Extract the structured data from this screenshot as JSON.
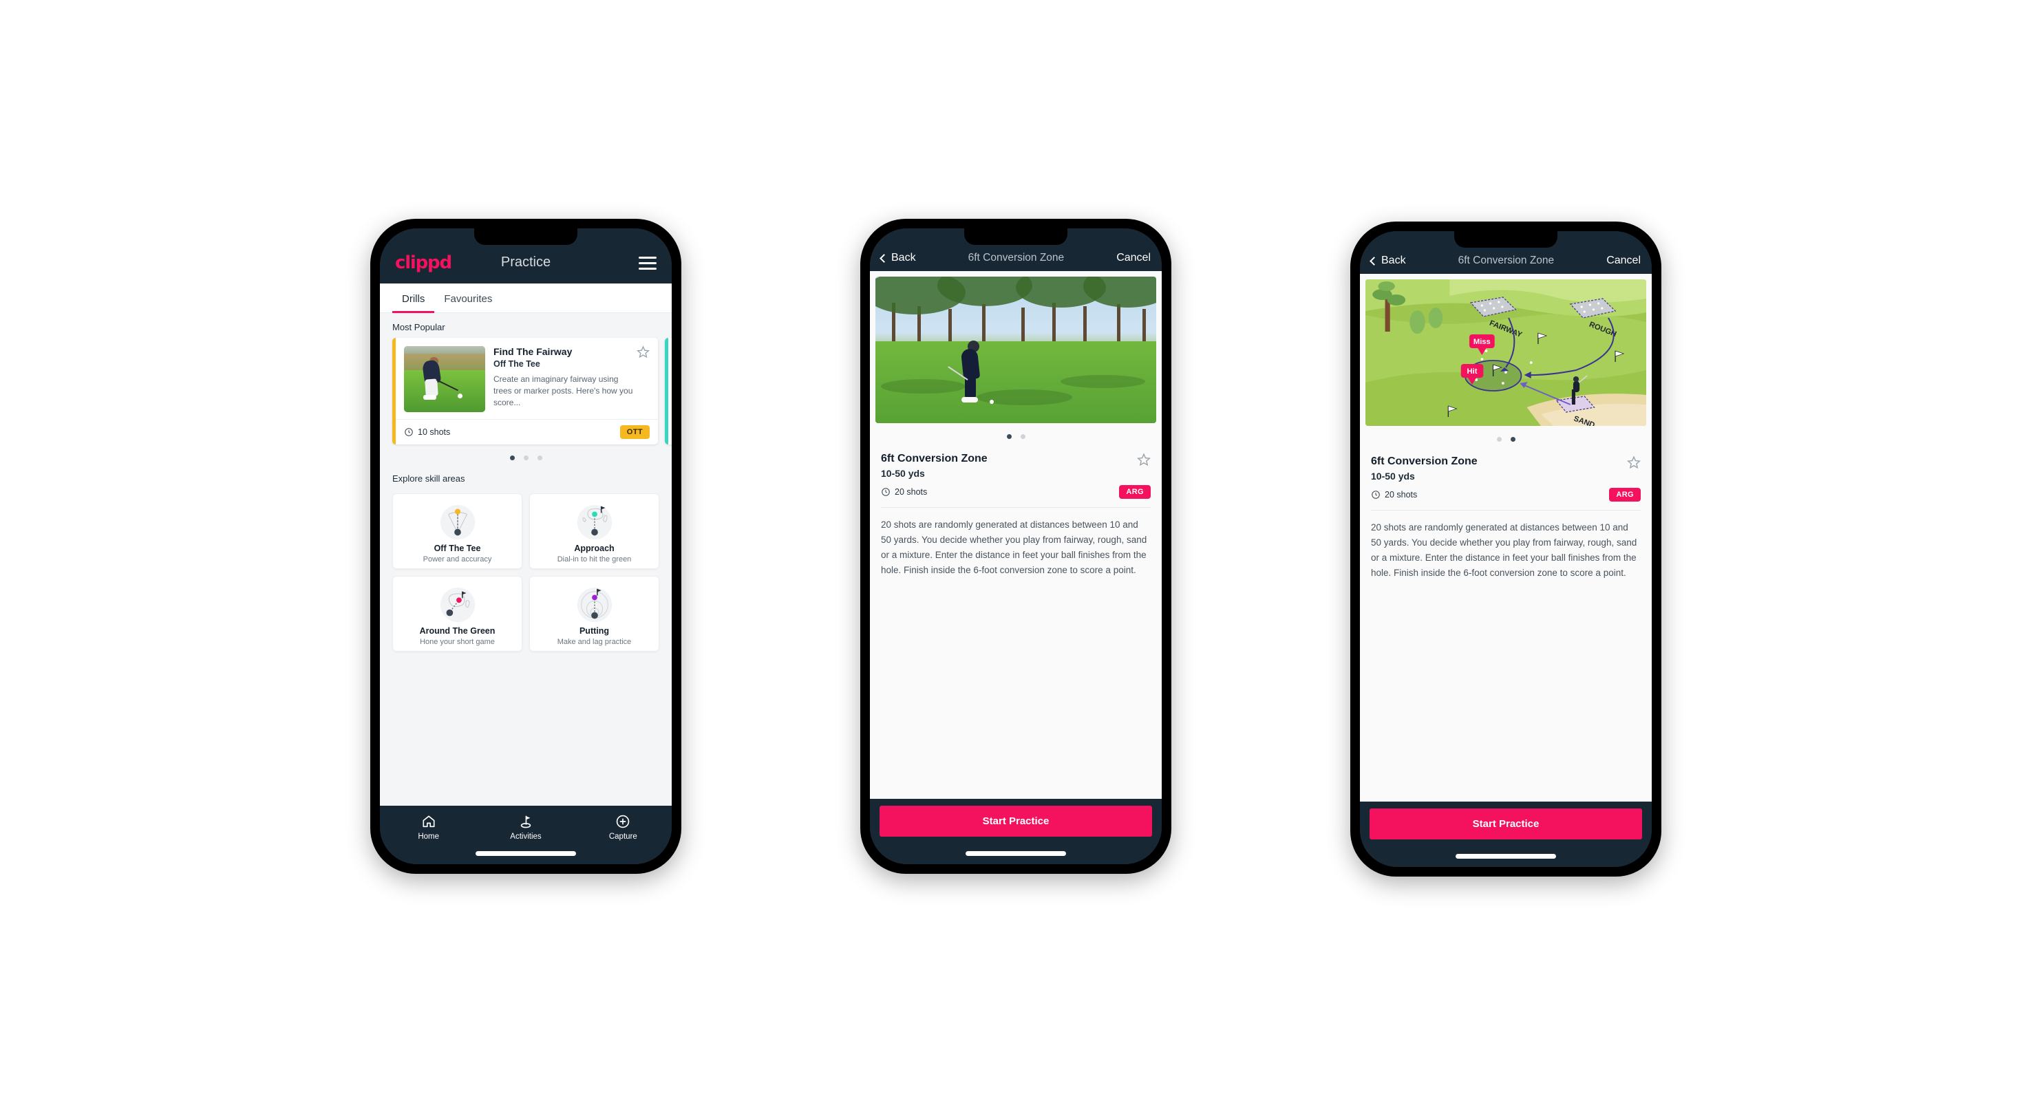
{
  "brand": {
    "logo_text": "clippd",
    "accent_pink": "#F4125F",
    "dark_navy": "#182734",
    "amber": "#F5B820",
    "teal": "#36D6C3"
  },
  "phone1": {
    "header": {
      "title": "Practice",
      "menu_icon": "hamburger-icon"
    },
    "tabs": [
      {
        "label": "Drills",
        "active": true
      },
      {
        "label": "Favourites",
        "active": false
      }
    ],
    "most_popular": {
      "section_label": "Most Popular",
      "card": {
        "title": "Find The Fairway",
        "subtitle": "Off The Tee",
        "description": "Create an imaginary fairway using trees or marker posts. Here's how you score...",
        "shots": "10 shots",
        "badge": "OTT",
        "accent": "#F5B820",
        "star_icon": "star-outline-icon",
        "clock_icon": "clock-icon"
      },
      "peek_accent": "#36D6C3",
      "dots": [
        {
          "active": true
        },
        {
          "active": false
        },
        {
          "active": false
        }
      ]
    },
    "explore": {
      "section_label": "Explore skill areas",
      "cards": [
        {
          "name": "Off The Tee",
          "desc": "Power and accuracy",
          "icon": "off-the-tee-icon",
          "dot_color": "#F5B820"
        },
        {
          "name": "Approach",
          "desc": "Dial-in to hit the green",
          "icon": "approach-icon",
          "dot_color": "#2ED9B5"
        },
        {
          "name": "Around The Green",
          "desc": "Hone your short game",
          "icon": "around-the-green-icon",
          "dot_color": "#F4125F"
        },
        {
          "name": "Putting",
          "desc": "Make and lag practice",
          "icon": "putting-icon",
          "dot_color": "#A020D8"
        }
      ]
    },
    "bottom_nav": [
      {
        "label": "Home",
        "icon": "home-icon",
        "active": false
      },
      {
        "label": "Activities",
        "icon": "golf-flag-icon",
        "active": true
      },
      {
        "label": "Capture",
        "icon": "plus-circle-icon",
        "active": false
      }
    ]
  },
  "phone2": {
    "nav": {
      "back": "Back",
      "title": "6ft Conversion Zone",
      "cancel": "Cancel",
      "back_icon": "chevron-left-icon"
    },
    "hero": {
      "type": "photo",
      "alt": "Golfer chipping on a green lined with pine trees"
    },
    "dots": [
      {
        "active": true
      },
      {
        "active": false
      }
    ],
    "detail": {
      "title": "6ft Conversion Zone",
      "range": "10-50 yds",
      "shots": "20 shots",
      "badge": "ARG",
      "star_icon": "star-outline-icon",
      "clock_icon": "clock-icon",
      "description": "20 shots are randomly generated at distances between 10 and 50 yards. You decide whether you play from fairway, rough, sand or a mixture. Enter the distance in feet your ball finishes from the hole. Finish inside the 6-foot conversion zone to score a point."
    },
    "cta": "Start Practice"
  },
  "phone3": {
    "nav": {
      "back": "Back",
      "title": "6ft Conversion Zone",
      "cancel": "Cancel",
      "back_icon": "chevron-left-icon"
    },
    "hero": {
      "type": "diagram",
      "alt": "Illustrated golf hole showing shots played to the green",
      "zone_labels": [
        "FAIRWAY",
        "ROUGH",
        "SAND"
      ],
      "callouts": [
        "Miss",
        "Hit"
      ]
    },
    "dots": [
      {
        "active": false
      },
      {
        "active": true
      }
    ],
    "detail": {
      "title": "6ft Conversion Zone",
      "range": "10-50 yds",
      "shots": "20 shots",
      "badge": "ARG",
      "star_icon": "star-outline-icon",
      "clock_icon": "clock-icon",
      "description": "20 shots are randomly generated at distances between 10 and 50 yards. You decide whether you play from fairway, rough, sand or a mixture. Enter the distance in feet your ball finishes from the hole. Finish inside the 6-foot conversion zone to score a point."
    },
    "cta": "Start Practice"
  }
}
